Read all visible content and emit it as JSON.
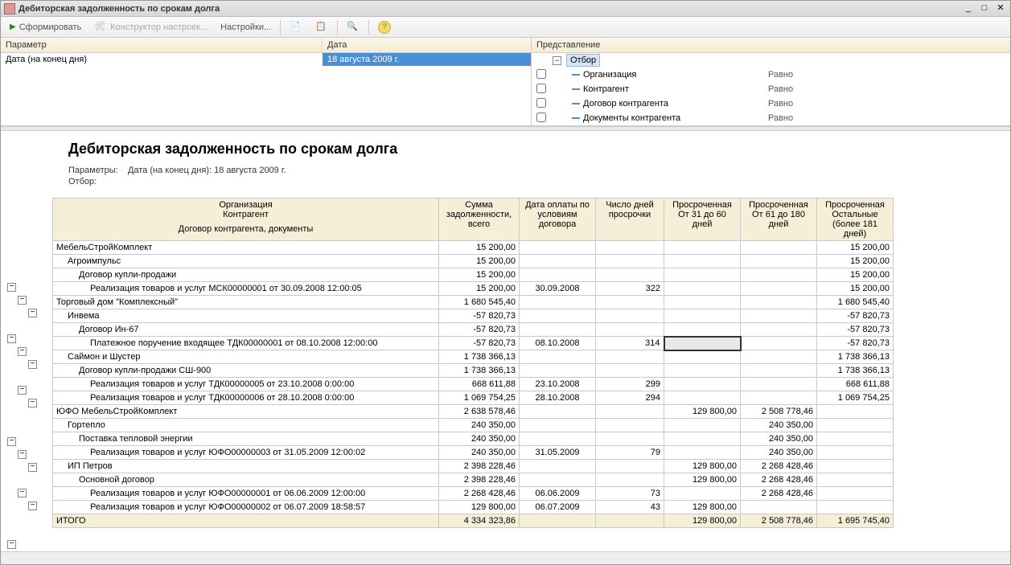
{
  "window": {
    "title": "Дебиторская задолженность по срокам долга"
  },
  "toolbar": {
    "form": "Сформировать",
    "constructor": "Конструктор настроек...",
    "settings": "Настройки..."
  },
  "params_panel": {
    "header_param": "Параметр",
    "header_date": "Дата",
    "row_param": "Дата (на конец дня)",
    "row_date": "18 августа 2009 г."
  },
  "filter_panel": {
    "header": "Представление",
    "root": "Отбор",
    "items": [
      {
        "label": "Организация",
        "cond": "Равно"
      },
      {
        "label": "Контрагент",
        "cond": "Равно"
      },
      {
        "label": "Договор контрагента",
        "cond": "Равно"
      },
      {
        "label": "Документы контрагента",
        "cond": "Равно"
      }
    ]
  },
  "report": {
    "title": "Дебиторская задолженность по срокам долга",
    "params_label": "Параметры:",
    "params_value": "Дата (на конец дня): 18 августа 2009 г.",
    "filter_label": "Отбор:",
    "headers": {
      "org_line1": "Организация",
      "org_line2": "Контрагент",
      "org_line3": "Договор контрагента, документы",
      "sum": "Сумма задолженности, всего",
      "paydate": "Дата оплаты по условиям договора",
      "days": "Число дней просрочки",
      "ov31": "Просроченная От 31 до 60 дней",
      "ov61": "Просроченная От 61 до 180 дней",
      "ovrest": "Просроченная Остальные (более 181 дней)"
    },
    "total_label": "ИТОГО",
    "rows": [
      {
        "lvl": 0,
        "name": "МебельСтройКомплект",
        "sum": "15 200,00",
        "rest": "15 200,00"
      },
      {
        "lvl": 1,
        "name": "Агроимпульс",
        "sum": "15 200,00",
        "rest": "15 200,00"
      },
      {
        "lvl": 2,
        "name": "Договор купли-продажи",
        "sum": "15 200,00",
        "rest": "15 200,00"
      },
      {
        "lvl": 3,
        "name": "Реализация товаров и услуг МСК00000001 от 30.09.2008 12:00:05",
        "sum": "15 200,00",
        "date": "30.09.2008",
        "days": "322",
        "rest": "15 200,00"
      },
      {
        "lvl": 0,
        "name": "Торговый дом \"Комплексный\"",
        "sum": "1 680 545,40",
        "rest": "1 680 545,40"
      },
      {
        "lvl": 1,
        "name": "Инвема",
        "sum": "-57 820,73",
        "rest": "-57 820,73"
      },
      {
        "lvl": 2,
        "name": "Договор Ин-67",
        "sum": "-57 820,73",
        "rest": "-57 820,73"
      },
      {
        "lvl": 3,
        "name": "Платежное поручение входящее ТДК00000001 от 08.10.2008 12:00:00",
        "sum": "-57 820,73",
        "date": "08.10.2008",
        "days": "314",
        "ov31_sel": true,
        "rest": "-57 820,73"
      },
      {
        "lvl": 1,
        "name": "Саймон и Шустер",
        "sum": "1 738 366,13",
        "rest": "1 738 366,13"
      },
      {
        "lvl": 2,
        "name": "Договор купли-продажи СШ-900",
        "sum": "1 738 366,13",
        "rest": "1 738 366,13"
      },
      {
        "lvl": 3,
        "name": "Реализация товаров и услуг ТДК00000005 от 23.10.2008 0:00:00",
        "sum": "668 611,88",
        "date": "23.10.2008",
        "days": "299",
        "rest": "668 611,88"
      },
      {
        "lvl": 3,
        "name": "Реализация товаров и услуг ТДК00000006 от 28.10.2008 0:00:00",
        "sum": "1 069 754,25",
        "date": "28.10.2008",
        "days": "294",
        "rest": "1 069 754,25"
      },
      {
        "lvl": 0,
        "name": "ЮФО МебельСтройКомплект",
        "sum": "2 638 578,46",
        "ov31": "129 800,00",
        "ov61": "2 508 778,46"
      },
      {
        "lvl": 1,
        "name": "Гортепло",
        "sum": "240 350,00",
        "ov61": "240 350,00"
      },
      {
        "lvl": 2,
        "name": "Поставка тепловой энергии",
        "sum": "240 350,00",
        "ov61": "240 350,00"
      },
      {
        "lvl": 3,
        "name": "Реализация товаров и услуг ЮФО00000003 от 31.05.2009 12:00:02",
        "sum": "240 350,00",
        "date": "31.05.2009",
        "days": "79",
        "ov61": "240 350,00"
      },
      {
        "lvl": 1,
        "name": "ИП Петров",
        "sum": "2 398 228,46",
        "ov31": "129 800,00",
        "ov61": "2 268 428,46"
      },
      {
        "lvl": 2,
        "name": "Основной договор",
        "sum": "2 398 228,46",
        "ov31": "129 800,00",
        "ov61": "2 268 428,46"
      },
      {
        "lvl": 3,
        "name": "Реализация товаров и услуг ЮФО00000001 от 06.06.2009 12:00:00",
        "sum": "2 268 428,46",
        "date": "06.06.2009",
        "days": "73",
        "ov61": "2 268 428,46"
      },
      {
        "lvl": 3,
        "name": "Реализация товаров и услуг ЮФО00000002 от 06.07.2009 18:58:57",
        "sum": "129 800,00",
        "date": "06.07.2009",
        "days": "43",
        "ov31": "129 800,00"
      }
    ],
    "total": {
      "sum": "4 334 323,86",
      "ov31": "129 800,00",
      "ov61": "2 508 778,46",
      "rest": "1 695 745,40"
    }
  }
}
